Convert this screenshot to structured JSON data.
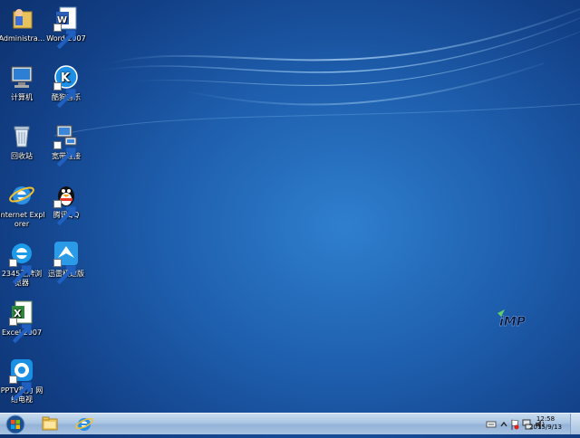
{
  "desktop": {
    "icons": [
      {
        "label": "Administra..."
      },
      {
        "label": "Word 2007"
      },
      {
        "label": "计算机"
      },
      {
        "label": "酷狗音乐"
      },
      {
        "label": "回收站"
      },
      {
        "label": "宽带连接"
      },
      {
        "label": "Internet Explorer"
      },
      {
        "label": "腾讯QQ"
      },
      {
        "label": "2345王牌浏览器"
      },
      {
        "label": "迅雷极速版"
      },
      {
        "label": "Excel 2007"
      },
      {
        "label": "PPTV聚力 网络电视"
      }
    ]
  },
  "taskbar": {
    "clock_time": "12:58",
    "clock_date": "2015/9/13"
  },
  "colors": {
    "desktop_blue": "#1e5fae",
    "taskbar": "#a9c4e2"
  }
}
